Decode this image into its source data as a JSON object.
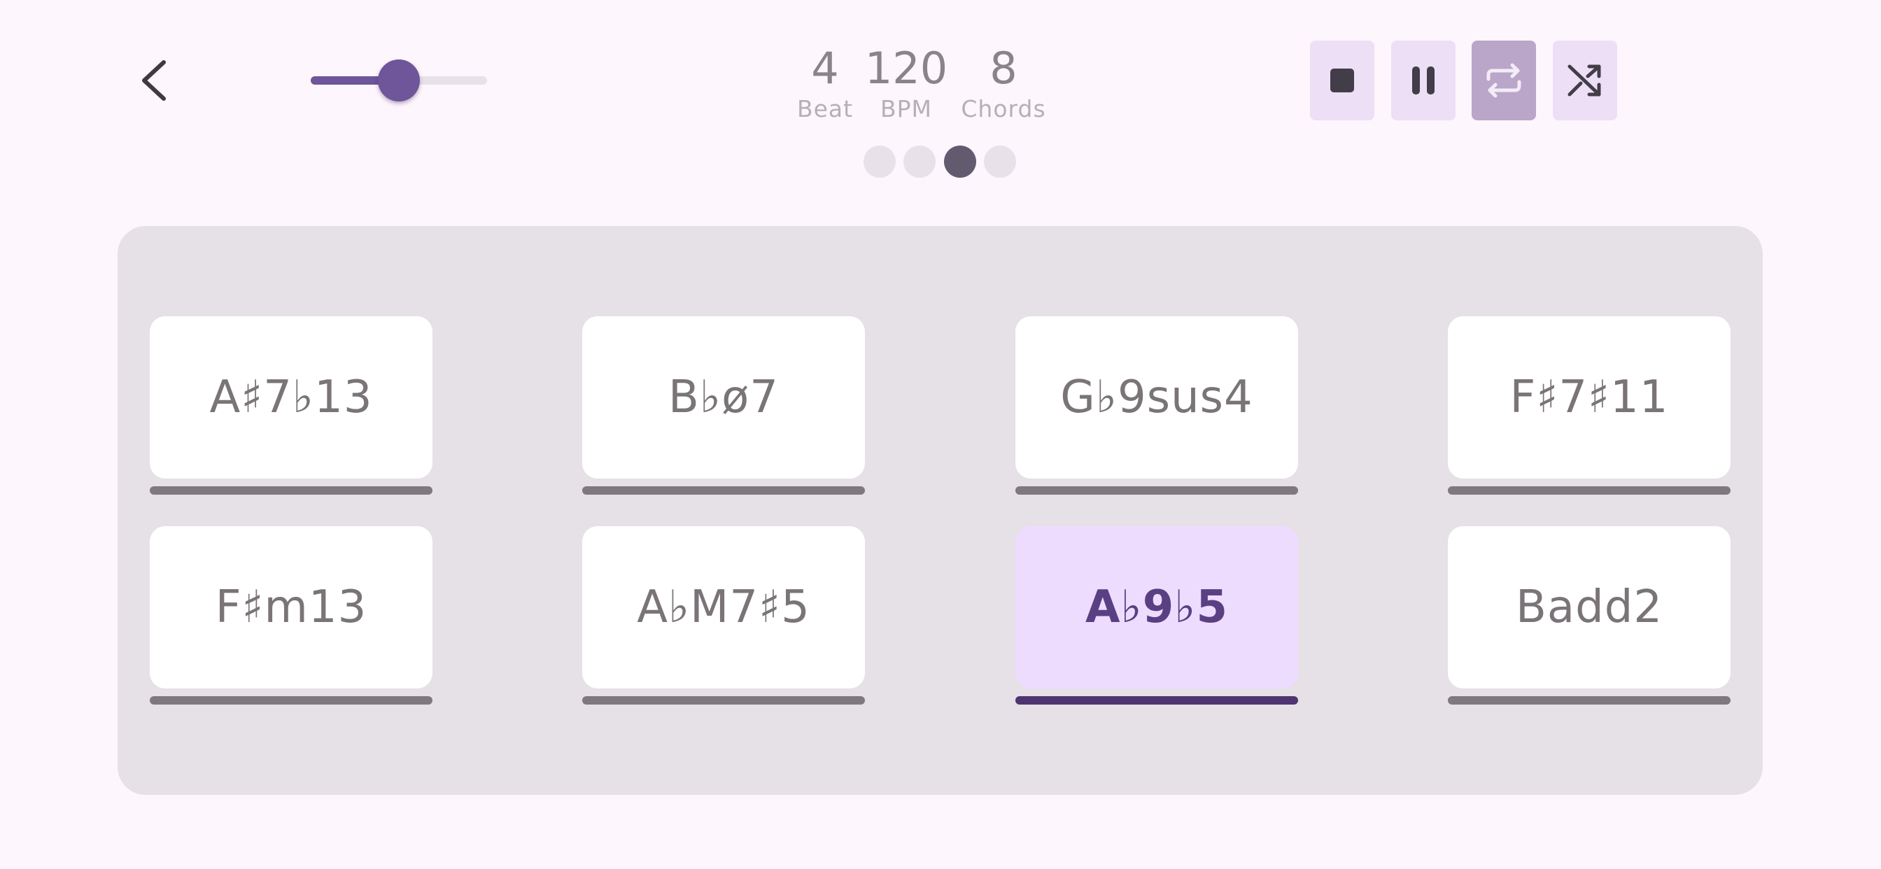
{
  "header": {
    "back_icon": "chevron-left-icon",
    "volume": {
      "value": 0.5
    }
  },
  "stats": {
    "beat": {
      "value": "4",
      "label": "Beat"
    },
    "bpm": {
      "value": "120",
      "label": "BPM"
    },
    "chords": {
      "value": "8",
      "label": "Chords"
    }
  },
  "pages": {
    "count": 4,
    "active": 3
  },
  "controls": [
    {
      "icon": "stop-icon",
      "selected": false
    },
    {
      "icon": "pause-icon",
      "selected": false
    },
    {
      "icon": "repeat-icon",
      "selected": true
    },
    {
      "icon": "shuffle-icon",
      "selected": false
    }
  ],
  "chords": [
    {
      "label": "A♯7♭13",
      "active": false
    },
    {
      "label": "B♭ø7",
      "active": false
    },
    {
      "label": "G♭9sus4",
      "active": false
    },
    {
      "label": "F♯7♯11",
      "active": false
    },
    {
      "label": "F♯m13",
      "active": false
    },
    {
      "label": "A♭M7♯5",
      "active": false
    },
    {
      "label": "A♭9♭5",
      "active": true
    },
    {
      "label": "Badd2",
      "active": false
    }
  ],
  "colors": {
    "background": "#fdf6fd",
    "accent": "#6f5599",
    "panel": "#e6e0e7",
    "active_chord": "#eddcfd",
    "active_chord_text": "#5a3f83"
  }
}
